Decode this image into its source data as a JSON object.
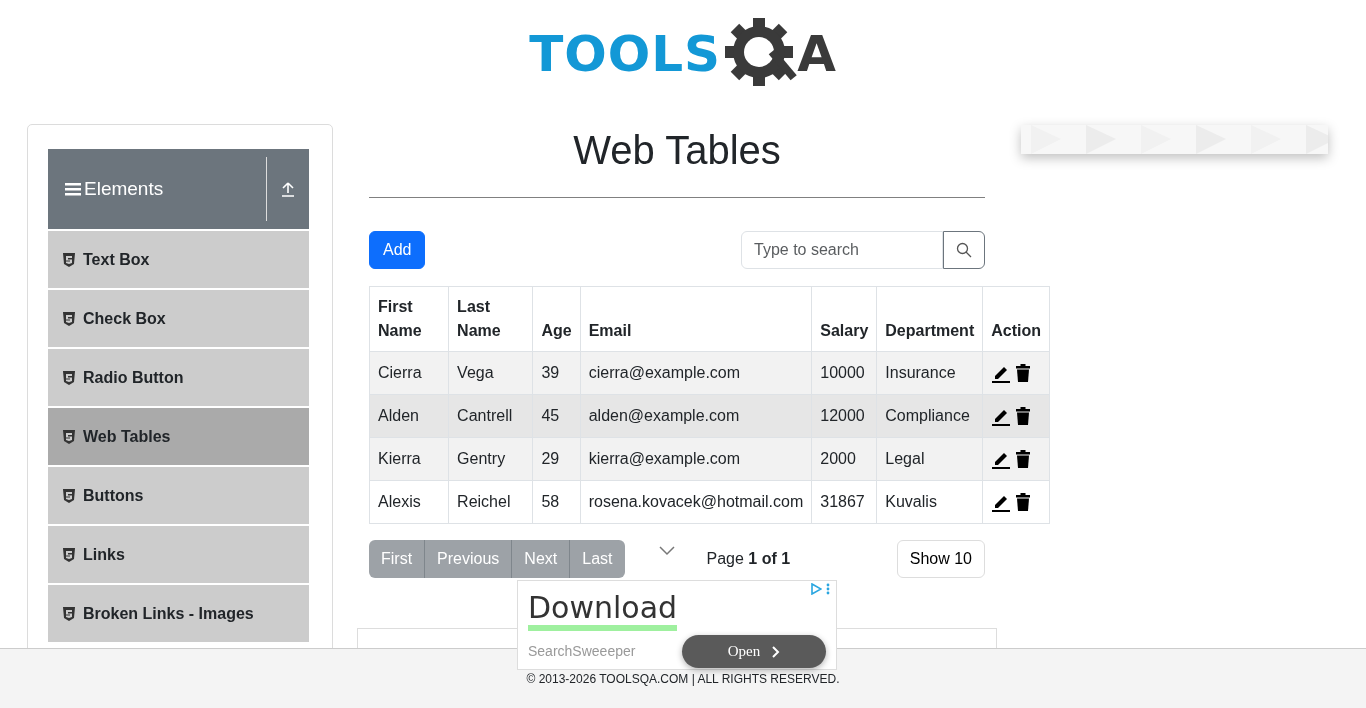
{
  "logo": {
    "text": "TOOLS",
    "suffix": "A"
  },
  "sidebar": {
    "group": "Elements",
    "items": [
      {
        "label": "Text Box",
        "selected": false
      },
      {
        "label": "Check Box",
        "selected": false
      },
      {
        "label": "Radio Button",
        "selected": false
      },
      {
        "label": "Web Tables",
        "selected": true
      },
      {
        "label": "Buttons",
        "selected": false
      },
      {
        "label": "Links",
        "selected": false
      },
      {
        "label": "Broken Links - Images",
        "selected": false
      }
    ]
  },
  "title": "Web Tables",
  "add_button": "Add",
  "search": {
    "placeholder": "Type to search"
  },
  "table": {
    "columns": [
      "First Name",
      "Last Name",
      "Age",
      "Email",
      "Salary",
      "Department",
      "Action"
    ],
    "rows": [
      {
        "cells": [
          "Cierra",
          "Vega",
          "39",
          "cierra@example.com",
          "10000",
          "Insurance"
        ],
        "hovered": false
      },
      {
        "cells": [
          "Alden",
          "Cantrell",
          "45",
          "alden@example.com",
          "12000",
          "Compliance"
        ],
        "hovered": true
      },
      {
        "cells": [
          "Kierra",
          "Gentry",
          "29",
          "kierra@example.com",
          "2000",
          "Legal"
        ],
        "hovered": false
      },
      {
        "cells": [
          "Alexis",
          "Reichel",
          "58",
          "rosena.kovacek@hotmail.com",
          "31867",
          "Kuvalis"
        ],
        "hovered": false
      }
    ]
  },
  "pagination": {
    "buttons": [
      {
        "label": "First",
        "disabled": true
      },
      {
        "label": "Previous",
        "disabled": true
      },
      {
        "label": "Next",
        "disabled": true
      },
      {
        "label": "Last",
        "disabled": true
      }
    ],
    "page": "Page **1 of 1**",
    "page_size": "Show 10"
  },
  "ad": {
    "headline": "Download",
    "advertiser": "SearchSweeeper",
    "button": "Open"
  },
  "footer": "© 2013-2026 TOOLSQA.COM | ALL RIGHTS RESERVED."
}
